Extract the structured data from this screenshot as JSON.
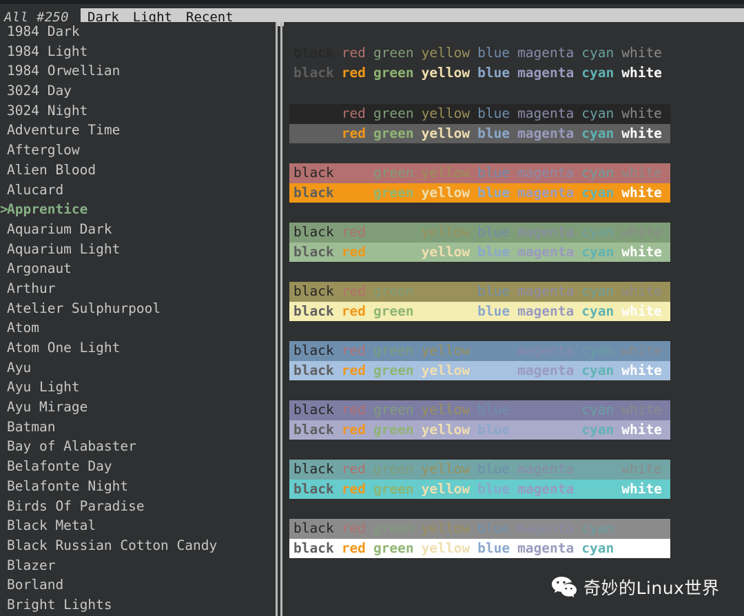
{
  "window": {
    "background": "#2f3031",
    "menubar_background": "#cdcdcd"
  },
  "header": {
    "counter": "All #250",
    "menu": [
      {
        "accel": "D",
        "rest": "ark",
        "name": "dark"
      },
      {
        "accel": "L",
        "rest": "ight",
        "name": "light"
      },
      {
        "accel": "R",
        "rest": "ecent",
        "name": "recent"
      }
    ]
  },
  "sidebar": {
    "selected": "Apprentice",
    "selected_color": "#87af87",
    "caret": ">",
    "items": [
      "1984 Dark",
      "1984 Light",
      "1984 Orwellian",
      "3024 Day",
      "3024 Night",
      "Adventure Time",
      "Afterglow",
      "Alien Blood",
      "Alucard",
      "Apprentice",
      "Aquarium Dark",
      "Aquarium Light",
      "Argonaut",
      "Arthur",
      "Atelier Sulphurpool",
      "Atom",
      "Atom One Light",
      "Ayu",
      "Ayu Light",
      "Ayu Mirage",
      "Batman",
      "Bay of Alabaster",
      "Belafonte Day",
      "Belafonte Night",
      "Birds Of Paradise",
      "Black Metal",
      "Black Russian Cotton Candy",
      "Blazer",
      "Borland",
      "Bright Lights"
    ]
  },
  "preview": {
    "words": [
      "black",
      "red",
      "green",
      "yellow",
      "blue",
      "magenta",
      "cyan",
      "white"
    ],
    "palette": {
      "normal": {
        "black": "#262626",
        "red": "#b3706f",
        "green": "#7f9d79",
        "yellow": "#9a9059",
        "blue": "#6e8eae",
        "magenta": "#8a8aab",
        "cyan": "#69a0a0",
        "white": "#8b8b8b"
      },
      "bright": {
        "black": "#5f5f5f",
        "red": "#f29718",
        "green": "#8fb573",
        "yellow": "#f0dfaf",
        "blue": "#8ba8cc",
        "magenta": "#9a9abf",
        "cyan": "#5fb3b3",
        "white": "#ffffff"
      }
    },
    "blocks": [
      {
        "name": "default-background",
        "bg_normal": "#2f3031",
        "bg_bright": "#2f3031",
        "hidden": null
      },
      {
        "name": "black-background",
        "bg_normal": "#262626",
        "bg_bright": "#5f5f5f",
        "hidden": "black"
      },
      {
        "name": "red-background",
        "bg_normal": "#b3706f",
        "bg_bright": "#f29718",
        "hidden": "red"
      },
      {
        "name": "green-background",
        "bg_normal": "#7f9d79",
        "bg_bright": "#9dbd94",
        "hidden": "green"
      },
      {
        "name": "yellow-background",
        "bg_normal": "#9a9059",
        "bg_bright": "#f4eeb2",
        "hidden": "yellow"
      },
      {
        "name": "blue-background",
        "bg_normal": "#6e8eae",
        "bg_bright": "#a7c1e0",
        "hidden": "blue"
      },
      {
        "name": "magenta-background",
        "bg_normal": "#7d7da3",
        "bg_bright": "#aaaacb",
        "hidden": "magenta"
      },
      {
        "name": "cyan-background",
        "bg_normal": "#72a5a5",
        "bg_bright": "#66cccc",
        "hidden": "cyan"
      },
      {
        "name": "white-background",
        "bg_normal": "#8b8b8b",
        "bg_bright": "#ffffff",
        "hidden": "white"
      }
    ]
  },
  "watermark": {
    "label": "奇妙的Linux世界",
    "icon": "wechat-icon"
  }
}
